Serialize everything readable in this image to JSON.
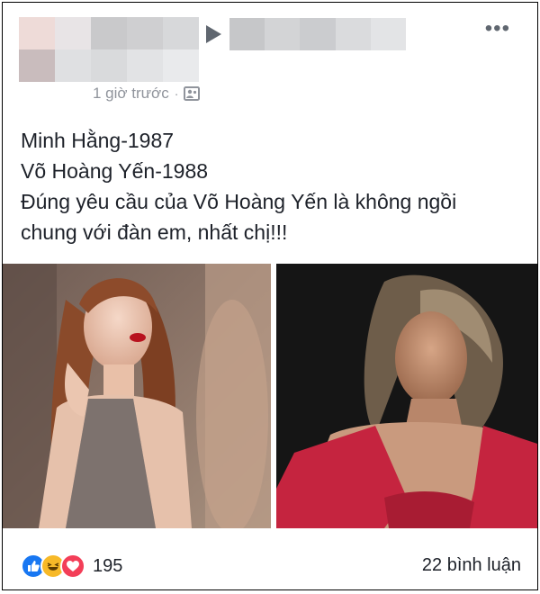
{
  "post": {
    "author_blurred": true,
    "timestamp": "1 giờ trước",
    "separator": "·",
    "privacy_icon": "friends-photo-icon",
    "text_lines": [
      "Minh Hằng-1987",
      "Võ Hoàng Yến-1988",
      "Đúng yêu cầu của Võ Hoàng Yến là không ngồi",
      "chung với đàn em, nhất chị!!!"
    ]
  },
  "reactions": {
    "icons": [
      "like-icon",
      "haha-icon",
      "love-icon"
    ],
    "count": "195"
  },
  "comments": {
    "label": "22 bình luận"
  },
  "colors": {
    "like": "#1877f2",
    "haha": "#f7b928",
    "love": "#f33e58",
    "meta_text": "#90949c",
    "photo2_jacket": "#c5243f"
  }
}
